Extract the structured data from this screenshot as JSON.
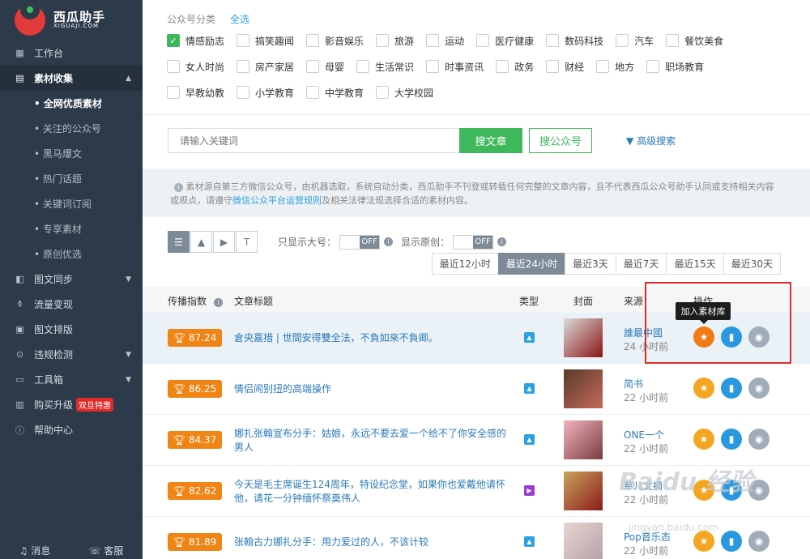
{
  "brand": {
    "name": "西瓜助手",
    "domain": "XIGUAJI.COM"
  },
  "sidebar": {
    "items": [
      {
        "label": "工作台",
        "icon": "grid-icon"
      },
      {
        "label": "素材收集",
        "icon": "folder-icon",
        "active": true
      },
      {
        "label": "图文同步",
        "icon": "sync-icon"
      },
      {
        "label": "流量变现",
        "icon": "money-bag-icon"
      },
      {
        "label": "图文排版",
        "icon": "layout-icon"
      },
      {
        "label": "违规检测",
        "icon": "check-icon"
      },
      {
        "label": "工具箱",
        "icon": "toolbox-icon"
      },
      {
        "label": "购买升级",
        "icon": "cart-icon",
        "badge": "双旦特惠"
      },
      {
        "label": "帮助中心",
        "icon": "help-icon"
      }
    ],
    "sub_items": [
      "• 全网优质素材",
      "• 关注的公众号",
      "• 黑马爆文",
      "• 热门话题",
      "• 关键词订阅",
      "• 专享素材",
      "• 原创优选"
    ],
    "bottom": {
      "messages": "消息",
      "service": "客服"
    }
  },
  "categories": {
    "label": "公众号分类",
    "all": "全选",
    "rows": [
      [
        "情感励志",
        "搞笑趣闻",
        "影音娱乐",
        "旅游",
        "运动",
        "医疗健康",
        "数码科技",
        "汽车",
        "餐饮美食"
      ],
      [
        "女人时尚",
        "房产家居",
        "母婴",
        "生活常识",
        "时事资讯",
        "政务",
        "财经",
        "地方",
        "职场教育"
      ],
      [
        "早教幼教",
        "小学教育",
        "中学教育",
        "大学校园"
      ]
    ]
  },
  "search": {
    "placeholder": "请输入关键词",
    "article_btn": "搜文章",
    "account_btn": "搜公众号",
    "advanced": "高级搜索"
  },
  "notice": {
    "text1": "素材源自第三方微信公众号，由机器选取，系统自动分类，西瓜助手不刊登或转载任何完整的文章内容，且不代表西瓜公众号助手认同或支持相关内容或观点，请遵守",
    "link": "微信公众平台运营规则",
    "text2": "及相关法律法规选择合适的素材内容。"
  },
  "filters": {
    "big_only": "只显示大号：",
    "original_only": "显示原创：",
    "off": "OFF"
  },
  "time_tabs": [
    "最近12小时",
    "最近24小时",
    "最近3天",
    "最近7天",
    "最近15天",
    "最近30天"
  ],
  "table": {
    "headers": {
      "score": "传播指数",
      "title": "文章标题",
      "type": "类型",
      "cover": "封面",
      "source": "来源",
      "ops": "操作"
    },
    "rows": [
      {
        "score": "87.24",
        "title": "倉央嘉措 | 世間安得雙全法，不負如來不負卿。",
        "type": "image",
        "source": "誰最中國",
        "time": "24 小时前",
        "cover": [
          "#dcdcdc",
          "#8a1414"
        ]
      },
      {
        "score": "86.25",
        "title": "情侣闹别扭的高端操作",
        "type": "image",
        "source": "简书",
        "time": "22 小时前",
        "cover": [
          "#5a3a2a",
          "#c46a5a"
        ]
      },
      {
        "score": "84.37",
        "title": "娜扎张翰宣布分手：姑娘，永远不要去爱一个给不了你安全感的男人",
        "type": "image",
        "source": "ONE一个",
        "time": "22 小时前",
        "cover": [
          "#f2b3c1",
          "#7a3c3c"
        ]
      },
      {
        "score": "82.62",
        "title": "今天是毛主席诞生124周年，特设纪念堂，如果你也爱戴他请怀他，请花一分钟缅怀祭奠伟人",
        "type": "video",
        "source": "草儿文摘",
        "time": "22 小时前",
        "cover": [
          "#caa25a",
          "#8a1c1c"
        ]
      },
      {
        "score": "81.89",
        "title": "张翰古力娜扎分手：用力爱过的人，不该计较",
        "type": "image",
        "source": "Pop音乐态",
        "time": "22 小时前",
        "cover": [
          "#e7d6d0",
          "#b6a0a8"
        ]
      }
    ]
  },
  "tooltip": "加入素材库",
  "watermark": {
    "main": "Baidu 经验",
    "sub": "jingyan.baidu.com"
  },
  "colors": {
    "green": "#3fb85c",
    "orange": "#f08516",
    "link": "#2a7ab8",
    "sidebar": "#2c3a49",
    "highlight": "#e02b2b"
  }
}
